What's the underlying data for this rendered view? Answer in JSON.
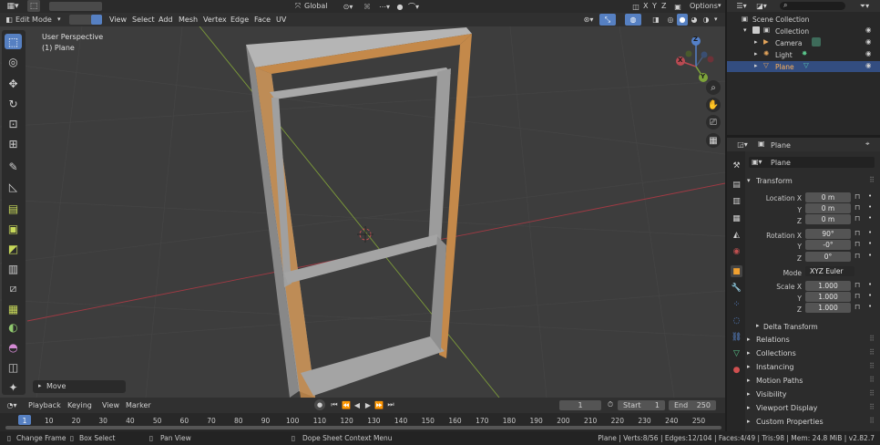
{
  "topbar": {
    "orientation": "Global",
    "options_label": "Options",
    "axes": [
      "X",
      "Y",
      "Z"
    ]
  },
  "header": {
    "mode": "Edit Mode",
    "menus": [
      "View",
      "Select",
      "Add",
      "Mesh",
      "Vertex",
      "Edge",
      "Face",
      "UV"
    ]
  },
  "viewport": {
    "perspective_label": "User Perspective",
    "object_label": "(1) Plane",
    "gizmo_axes": [
      "X",
      "Y",
      "Z"
    ],
    "operator_panel": "Move"
  },
  "outliner": {
    "root": "Scene Collection",
    "collection": "Collection",
    "items": [
      "Camera",
      "Light",
      "Plane"
    ],
    "selected": "Plane"
  },
  "properties": {
    "header_name": "Plane",
    "object_name": "Plane",
    "section": "Transform",
    "location_label": "Location X",
    "location": [
      "0 m",
      "0 m",
      "0 m"
    ],
    "rotation_label": "Rotation X",
    "rotation": [
      "90°",
      "-0°",
      "0°"
    ],
    "mode_label": "Mode",
    "mode_value": "XYZ Euler",
    "scale_label": "Scale X",
    "scale": [
      "1.000",
      "1.000",
      "1.000"
    ],
    "axis_y": "Y",
    "axis_z": "Z",
    "delta": "Delta Transform",
    "panels": [
      "Relations",
      "Collections",
      "Instancing",
      "Motion Paths",
      "Visibility",
      "Viewport Display",
      "Custom Properties"
    ]
  },
  "timeline": {
    "menus": [
      "Playback",
      "Keying",
      "View",
      "Marker"
    ],
    "current_frame": "1",
    "start_label": "Start",
    "start": "1",
    "end_label": "End",
    "end": "250",
    "ticks": [
      "1",
      "10",
      "20",
      "30",
      "40",
      "50",
      "60",
      "70",
      "80",
      "90",
      "100",
      "110",
      "120",
      "130",
      "140",
      "150",
      "160",
      "170",
      "180",
      "190",
      "200",
      "210",
      "220",
      "230",
      "240",
      "250"
    ]
  },
  "statusbar": {
    "left": [
      "Change Frame",
      "Box Select",
      "Pan View",
      "Dope Sheet Context Menu"
    ],
    "right": "Plane | Verts:8/56 | Edges:12/104 | Faces:4/49 | Tris:98 | Mem: 24.8 MiB | v2.82.7"
  },
  "colors": {
    "accent": "#5680c2",
    "frame_orange": "#c4894a",
    "frame_gray": "#9a9a9a",
    "viewport_bg": "#3d3d3d"
  }
}
